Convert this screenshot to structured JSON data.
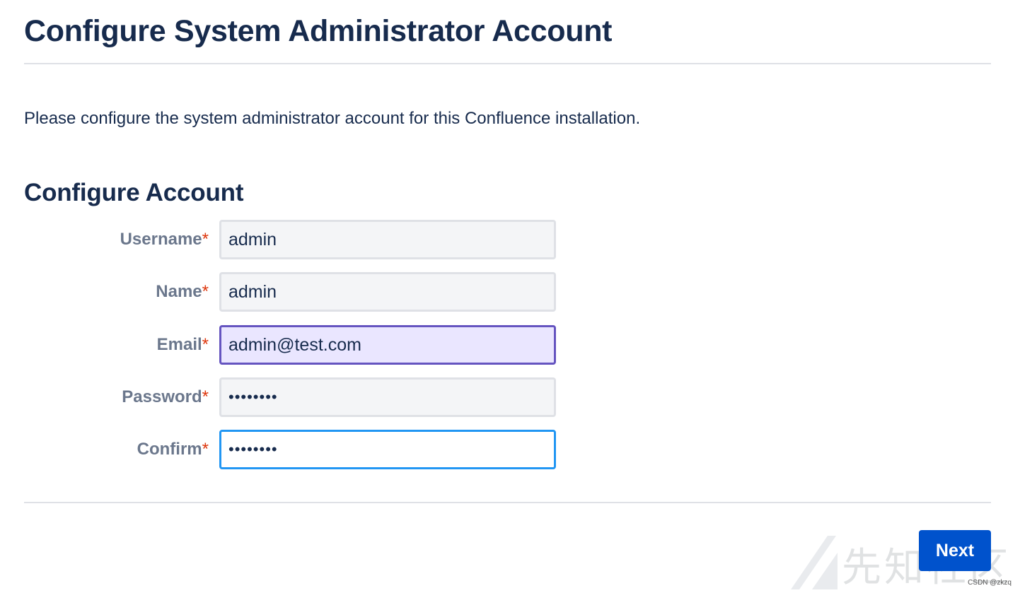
{
  "page": {
    "title": "Configure System Administrator Account",
    "intro": "Please configure the system administrator account for this Confluence installation.",
    "section_title": "Configure Account"
  },
  "form": {
    "required_marker": "*",
    "fields": [
      {
        "label": "Username",
        "value": "admin",
        "state": "default"
      },
      {
        "label": "Name",
        "value": "admin",
        "state": "default"
      },
      {
        "label": "Email",
        "value": "admin@test.com",
        "state": "autofilled"
      },
      {
        "label": "Password",
        "value": "••••••••",
        "state": "default"
      },
      {
        "label": "Confirm",
        "value": "••••••••",
        "state": "focused"
      }
    ]
  },
  "actions": {
    "next_label": "Next"
  },
  "watermark": {
    "text": "先知社区",
    "credit": "CSDN @zkzq"
  },
  "colors": {
    "heading": "#172B4D",
    "label": "#6B778C",
    "required": "#DE350B",
    "field_bg": "#F4F5F7",
    "field_border": "#DFE1E6",
    "autofill_bg": "#EAE6FF",
    "autofill_border": "#6554C0",
    "focus_border": "#2196F3",
    "primary_button": "#0052CC"
  }
}
